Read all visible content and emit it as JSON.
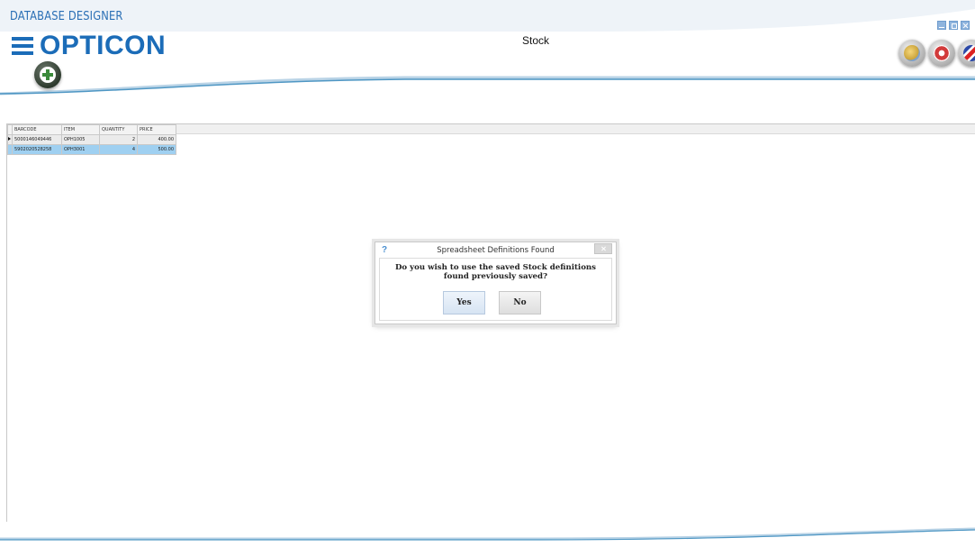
{
  "app": {
    "title": "DATABASE DESIGNER",
    "logo_text": "OPTICON",
    "page_heading": "Stock"
  },
  "toolbar": {
    "add_button_icon": "plus-circle-icon",
    "round_buttons": [
      {
        "name": "disc-settings-button",
        "icon": "disc-icon"
      },
      {
        "name": "help-lifebuoy-button",
        "icon": "lifebuoy-icon"
      },
      {
        "name": "language-button",
        "icon": "uk-flag-icon"
      }
    ]
  },
  "window_controls": [
    "minimize",
    "maximize",
    "close"
  ],
  "grid": {
    "columns": [
      "BARCODE",
      "ITEM",
      "QUANTITY",
      "PRICE"
    ],
    "rows": [
      {
        "barcode": "5000146049446",
        "item": "OPH1005",
        "quantity": "2",
        "price": "400.00",
        "state": "active"
      },
      {
        "barcode": "5902020528258",
        "item": "OPH3001",
        "quantity": "4",
        "price": "500.00",
        "state": "selected"
      }
    ]
  },
  "dialog": {
    "title": "Spreadsheet Definitions Found",
    "icon": "question-icon",
    "icon_glyph": "?",
    "message": "Do you wish to use the saved Stock definitions found previously saved?",
    "yes_label": "Yes",
    "no_label": "No"
  },
  "colors": {
    "brand_blue": "#1b6cb8",
    "wave_blue": "#5a9fc9",
    "selection_blue": "#9fd0f1"
  }
}
